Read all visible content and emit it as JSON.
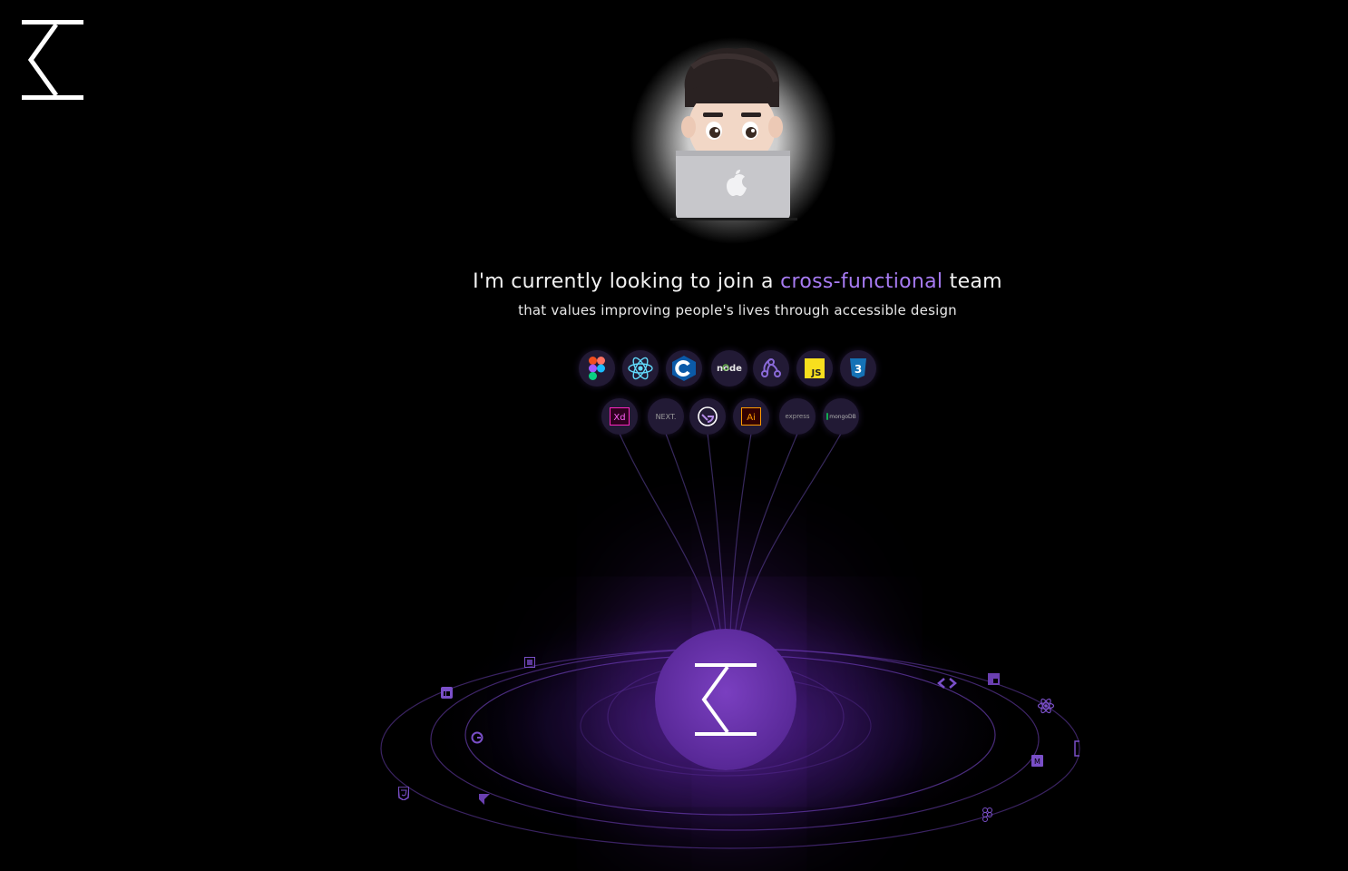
{
  "brand": {
    "logo_icon": "k-chevron-logo-icon"
  },
  "avatar": {
    "icon": "memoji-laptop-avatar-icon"
  },
  "hero": {
    "headline_pre": "I'm currently looking to join a ",
    "headline_accent": "cross-functional",
    "headline_post": " team",
    "subline": "that values improving people's lives through accessible design"
  },
  "skills_row1": [
    {
      "name": "figma-icon"
    },
    {
      "name": "react-icon"
    },
    {
      "name": "c-language-icon"
    },
    {
      "name": "node-icon",
      "label": "node"
    },
    {
      "name": "redux-icon"
    },
    {
      "name": "javascript-icon",
      "label": "JS"
    },
    {
      "name": "css3-icon",
      "label": "3"
    }
  ],
  "skills_row2": [
    {
      "name": "adobe-xd-icon",
      "label": "Xd"
    },
    {
      "name": "nextjs-icon",
      "label": "NEXT."
    },
    {
      "name": "gatsby-icon"
    },
    {
      "name": "adobe-illustrator-icon",
      "label": "Ai"
    },
    {
      "name": "express-icon",
      "label": "express"
    },
    {
      "name": "mongodb-icon",
      "label": "mongoDB"
    }
  ],
  "orbit": {
    "hub_icon": "k-chevron-logo-icon",
    "icons": [
      "illustrator-icon",
      "linkedin-icon",
      "gatsby-icon",
      "html5-icon",
      "framer-icon",
      "code-brackets-icon",
      "javascript-icon",
      "react-icon",
      "medium-icon",
      "figma-icon",
      "bracket-icon"
    ]
  },
  "colors": {
    "accent": "#a77bf3",
    "hub": "#6a33b0",
    "line": "#4b3a78"
  }
}
